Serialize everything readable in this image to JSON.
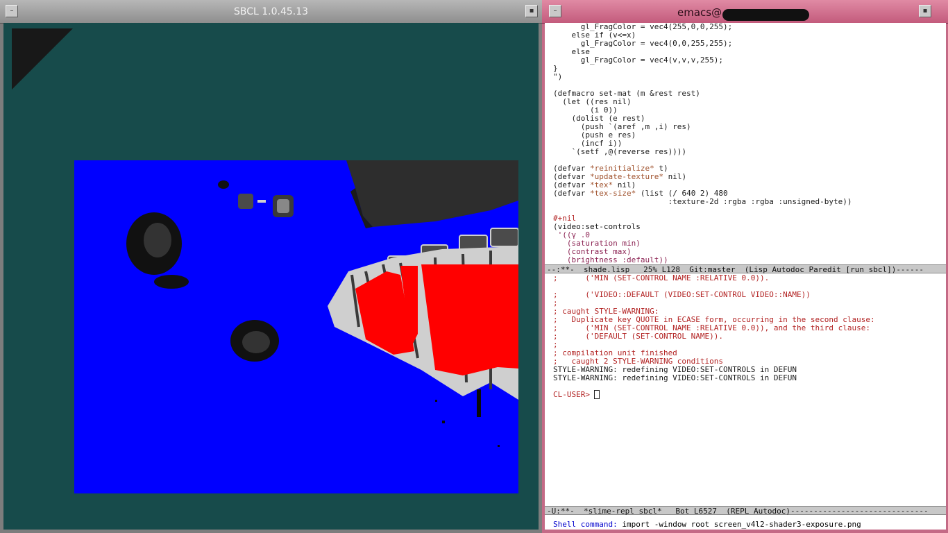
{
  "sbcl": {
    "title": "SBCL 1.0.45.13",
    "menu_button": "–",
    "max_button": "▪"
  },
  "emacs": {
    "title": "emacs@",
    "menu_button": "–",
    "max_button": "▪",
    "code_lines": [
      "      gl_FragColor = vec4(255,0,0,255);",
      "    else if (v<=x)",
      "      gl_FragColor = vec4(0,0,255,255);",
      "    else",
      "      gl_FragColor = vec4(v,v,v,255);",
      "}",
      "\")",
      "",
      "(defmacro set-mat (m &rest rest)",
      "  (let ((res nil)",
      "        (i 0))",
      "    (dolist (e rest)",
      "      (push `(aref ,m ,i) res)",
      "      (push e res)",
      "      (incf i))",
      "    `(setf ,@(reverse res))))",
      "",
      "(defvar *reinitialize* t)",
      "(defvar *update-texture* nil)",
      "(defvar *tex* nil)",
      "(defvar *tex-size* (list (/ 640 2) 480",
      "                         :texture-2d :rgba :rgba :unsigned-byte))",
      "",
      "#+nil",
      "(video:set-controls",
      " '((γ .0",
      "   (saturation min)",
      "   (contrast max)",
      "   (brightness :default))"
    ],
    "top_modeline": "--:**-  shade.lisp   25% L128  Git:master  (Lisp Autodoc Paredit [run sbcl])------",
    "repl_lines": [
      ";      ('MIN (SET-CONTROL NAME :RELATIVE 0.0)).",
      "",
      ";      ('VIDEO::DEFAULT (VIDEO:SET-CONTROL VIDEO::NAME))",
      ";",
      "; caught STYLE-WARNING:",
      ";   Duplicate key QUOTE in ECASE form, occurring in the second clause:",
      ";      ('MIN (SET-CONTROL NAME :RELATIVE 0.0)), and the third clause:",
      ";      ('DEFAULT (SET-CONTROL NAME)).",
      ";",
      "; compilation unit finished",
      ";   caught 2 STYLE-WARNING conditions",
      "STYLE-WARNING: redefining VIDEO:SET-CONTROLS in DEFUN",
      "STYLE-WARNING: redefining VIDEO:SET-CONTROLS in DEFUN",
      ""
    ],
    "repl_prompt": "CL-USER> ",
    "bottom_modeline": "-U:**-  *slime-repl sbcl*   Bot L6527  (REPL Autodoc)------------------------------",
    "minibuffer_prompt": "Shell command: ",
    "minibuffer_value": "import -window root screen_v4l2-shader3-exposure.png"
  }
}
